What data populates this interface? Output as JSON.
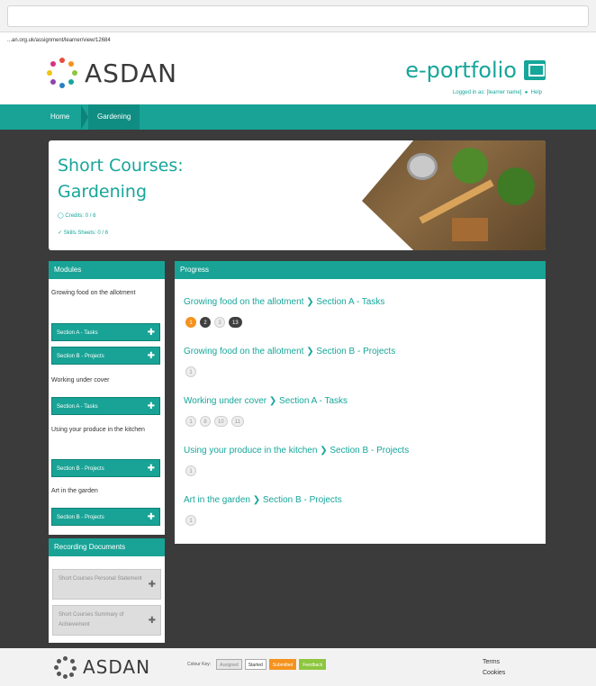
{
  "browser": {
    "url": "...an.org.uk/assignment/learner/view/12684"
  },
  "header": {
    "brand": "ASDAN",
    "portal_title": "e-portfolio",
    "logged_in_text": "Logged in as: [learner name]",
    "help_text": "Help"
  },
  "breadcrumb": {
    "home": "Home",
    "current": "Gardening"
  },
  "course": {
    "title_line1": "Short Courses:",
    "title_line2": "Gardening",
    "credits": "Credits: 0 / 6",
    "skills_sheets": "Skills Sheets: 0 / 6"
  },
  "modules": {
    "header": "Modules",
    "groups": [
      {
        "label": "Growing food on the allotment",
        "buttons": [
          "Section A - Tasks",
          "Section B - Projects"
        ]
      },
      {
        "label": "Working under cover",
        "buttons": [
          "Section A - Tasks"
        ]
      },
      {
        "label": "Using your produce in the kitchen",
        "buttons": [
          "Section B - Projects"
        ]
      },
      {
        "label": "Art in the garden",
        "buttons": [
          "Section B - Projects"
        ]
      }
    ]
  },
  "recording": {
    "header": "Recording Documents",
    "docs": [
      "Short Courses Personal Statement",
      "Short Courses Summary of Achievement"
    ]
  },
  "progress": {
    "header": "Progress",
    "rows": [
      {
        "module": "Growing food on the allotment",
        "section": "Section A - Tasks",
        "badges": [
          "1",
          "2",
          "3",
          "13"
        ]
      },
      {
        "module": "Growing food on the allotment",
        "section": "Section B - Projects",
        "badges": [
          "1"
        ]
      },
      {
        "module": "Working under cover",
        "section": "Section A - Tasks",
        "badges": [
          "1",
          "8",
          "10",
          "11"
        ]
      },
      {
        "module": "Using your produce in the kitchen",
        "section": "Section B - Projects",
        "badges": [
          "1"
        ]
      },
      {
        "module": "Art in the garden",
        "section": "Section B - Projects",
        "badges": [
          "1"
        ]
      }
    ]
  },
  "footer": {
    "brand": "ASDAN",
    "key_label": "Colour Key:",
    "keys": {
      "assigned": "Assigned",
      "started": "Started",
      "submitted": "Submitted",
      "feedback": "Feedback"
    },
    "terms": "Terms",
    "cookies": "Cookies"
  },
  "colors": {
    "accent": "#18a396",
    "orange": "#f5921e",
    "green": "#8dc63f",
    "dark": "#3b3b3b"
  }
}
